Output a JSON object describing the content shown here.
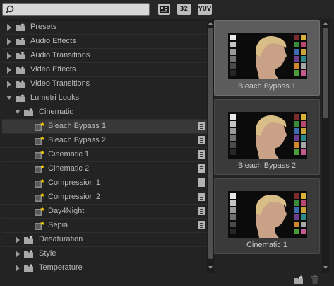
{
  "search": {
    "value": "",
    "placeholder": ""
  },
  "toolbar": {
    "buttons": [
      {
        "label": "▣",
        "icon": "accelerated-effects-icon"
      },
      {
        "label": "32",
        "icon": "32bit-effects-icon"
      },
      {
        "label": "YUV",
        "icon": "yuv-effects-icon"
      }
    ]
  },
  "tree": {
    "items": [
      {
        "label": "Presets",
        "level": 0,
        "expanded": false,
        "kind": "folder"
      },
      {
        "label": "Audio Effects",
        "level": 0,
        "expanded": false,
        "kind": "folder"
      },
      {
        "label": "Audio Transitions",
        "level": 0,
        "expanded": false,
        "kind": "folder"
      },
      {
        "label": "Video Effects",
        "level": 0,
        "expanded": false,
        "kind": "folder"
      },
      {
        "label": "Video Transitions",
        "level": 0,
        "expanded": false,
        "kind": "folder"
      },
      {
        "label": "Lumetri Looks",
        "level": 0,
        "expanded": true,
        "kind": "folder"
      },
      {
        "label": "Cinematic",
        "level": 1,
        "expanded": true,
        "kind": "folder"
      },
      {
        "label": "Bleach Bypass 1",
        "level": 2,
        "kind": "preset",
        "selected": true
      },
      {
        "label": "Bleach Bypass 2",
        "level": 2,
        "kind": "preset"
      },
      {
        "label": "Cinematic 1",
        "level": 2,
        "kind": "preset"
      },
      {
        "label": "Cinematic 2",
        "level": 2,
        "kind": "preset"
      },
      {
        "label": "Compression 1",
        "level": 2,
        "kind": "preset"
      },
      {
        "label": "Compression 2",
        "level": 2,
        "kind": "preset"
      },
      {
        "label": "Day4Night",
        "level": 2,
        "kind": "preset"
      },
      {
        "label": "Sepia",
        "level": 2,
        "kind": "preset"
      },
      {
        "label": "Desaturation",
        "level": 1,
        "expanded": false,
        "kind": "folder"
      },
      {
        "label": "Style",
        "level": 1,
        "expanded": false,
        "kind": "folder"
      },
      {
        "label": "Temperature",
        "level": 1,
        "expanded": false,
        "kind": "folder"
      }
    ]
  },
  "thumbnails": [
    {
      "caption": "Bleach Bypass 1",
      "selected": true
    },
    {
      "caption": "Bleach Bypass 2",
      "selected": false
    },
    {
      "caption": "Cinematic 1",
      "selected": false
    }
  ],
  "footer": {
    "new_folder_icon": "new-custom-bin-icon",
    "delete_icon": "trash-icon"
  },
  "colors": {
    "panel_bg": "#232323",
    "selected_row": "#383838",
    "text": "#b8b8b8",
    "folder": "#a8a8a8",
    "preset_star": "#ffd400"
  }
}
